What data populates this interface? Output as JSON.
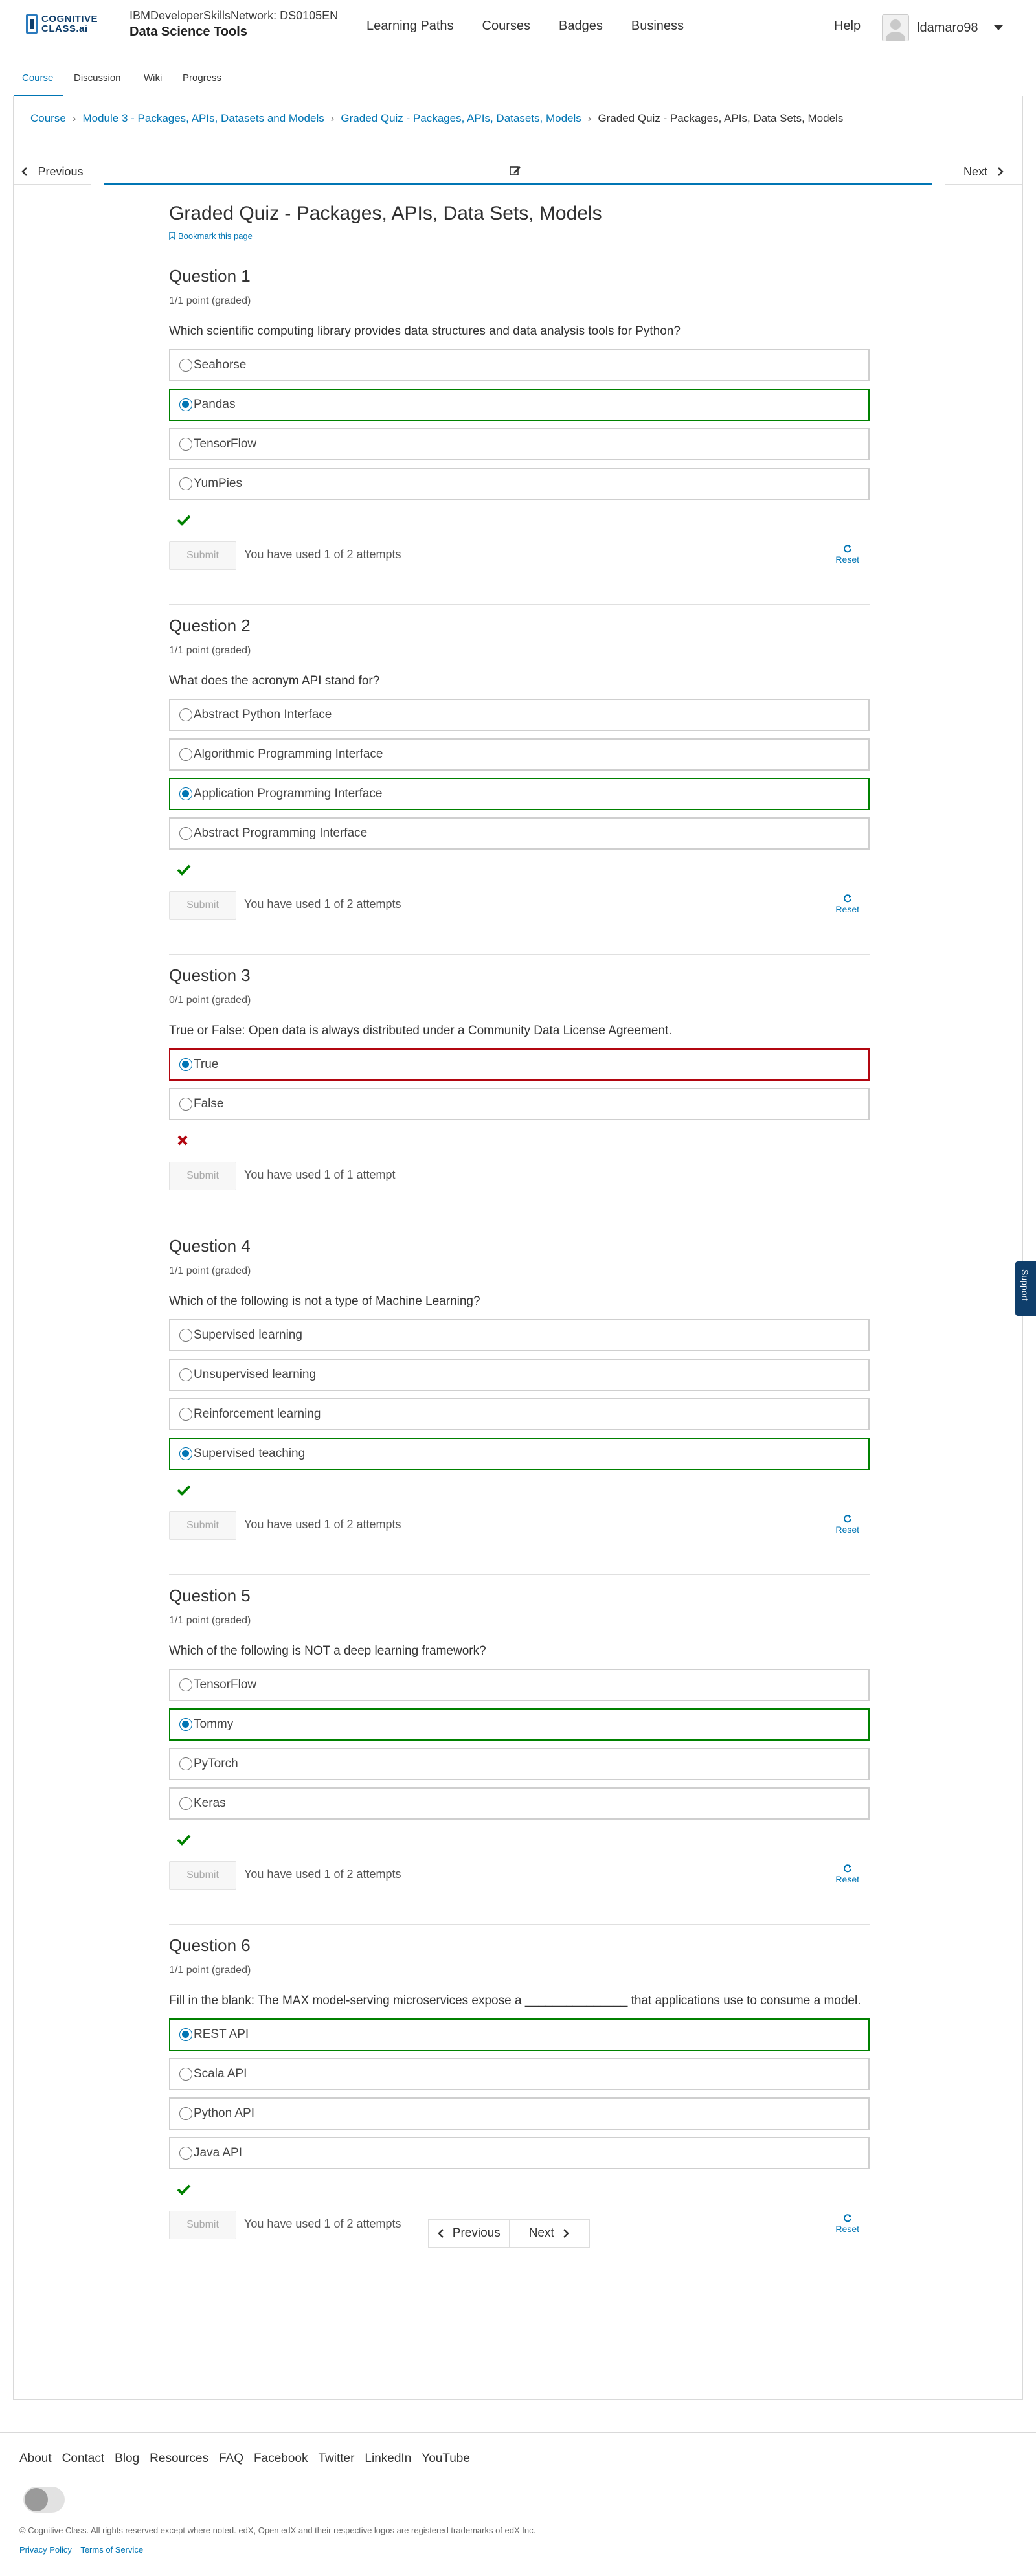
{
  "header": {
    "logo_line1": "COGNITIVE",
    "logo_line2": "CLASS.ai",
    "course_org": "IBMDeveloperSkillsNetwork: DS0105EN",
    "course_name": "Data Science Tools",
    "nav": [
      "Learning Paths",
      "Courses",
      "Badges",
      "Business"
    ],
    "help": "Help",
    "username": "ldamaro98"
  },
  "tabs": [
    "Course",
    "Discussion",
    "Wiki",
    "Progress"
  ],
  "breadcrumb": [
    "Course",
    "Module 3 - Packages, APIs, Datasets and Models",
    "Graded Quiz - Packages, APIs, Datasets, Models",
    "Graded Quiz - Packages, APIs, Data Sets, Models"
  ],
  "seqnav": {
    "previous": "Previous",
    "next": "Next"
  },
  "quiz": {
    "title": "Graded Quiz - Packages, APIs, Data Sets, Models",
    "bookmark": "Bookmark this page",
    "submit_label": "Submit",
    "reset_label": "Reset",
    "questions": [
      {
        "title": "Question 1",
        "points": "1/1 point (graded)",
        "text": "Which scientific computing library provides data structures and data analysis tools for Python?",
        "choices": [
          "Seahorse",
          "Pandas",
          "TensorFlow",
          "YumPies"
        ],
        "selected": 1,
        "result": "correct",
        "attempts": "You have used 1 of 2 attempts",
        "reset": true
      },
      {
        "title": "Question 2",
        "points": "1/1 point (graded)",
        "text": "What does the acronym API stand for?",
        "choices": [
          "Abstract Python Interface",
          "Algorithmic Programming Interface",
          "Application Programming Interface",
          "Abstract Programming Interface"
        ],
        "selected": 2,
        "result": "correct",
        "attempts": "You have used 1 of 2 attempts",
        "reset": true
      },
      {
        "title": "Question 3",
        "points": "0/1 point (graded)",
        "text": "True or False: Open data is always distributed under a Community Data License Agreement.",
        "choices": [
          "True",
          "False"
        ],
        "selected": 0,
        "result": "incorrect",
        "attempts": "You have used 1 of 1 attempt",
        "reset": false
      },
      {
        "title": "Question 4",
        "points": "1/1 point (graded)",
        "text": "Which of the following is not a type of Machine Learning?",
        "choices": [
          "Supervised learning",
          "Unsupervised learning",
          "Reinforcement learning",
          "Supervised teaching"
        ],
        "selected": 3,
        "result": "correct",
        "attempts": "You have used 1 of 2 attempts",
        "reset": true
      },
      {
        "title": "Question 5",
        "points": "1/1 point (graded)",
        "text": "Which of the following is NOT a deep learning framework?",
        "choices": [
          "TensorFlow",
          "Tommy",
          "PyTorch",
          "Keras"
        ],
        "selected": 1,
        "result": "correct",
        "attempts": "You have used 1 of 2 attempts",
        "reset": true
      },
      {
        "title": "Question 6",
        "points": "1/1 point (graded)",
        "text": "Fill in the blank: The MAX model-serving microservices expose a _______________ that applications use to consume a model.",
        "choices": [
          "REST API",
          "Scala API",
          "Python API",
          "Java API"
        ],
        "selected": 0,
        "result": "correct",
        "attempts": "You have used 1 of 2 attempts",
        "reset": true
      }
    ]
  },
  "bottom_nav": {
    "previous": "Previous",
    "next": "Next"
  },
  "support": "Support",
  "footer": {
    "links": [
      "About",
      "Contact",
      "Blog",
      "Resources",
      "FAQ",
      "Facebook",
      "Twitter",
      "LinkedIn",
      "YouTube"
    ],
    "copyright": "© Cognitive Class. All rights reserved except where noted. edX, Open edX and their respective logos are registered trademarks of edX Inc.",
    "legal": [
      "Privacy Policy",
      "Terms of Service"
    ]
  },
  "colors": {
    "accent": "#0075b4",
    "correct": "#008100",
    "incorrect": "#b20610",
    "brand": "#0f3e6b"
  }
}
